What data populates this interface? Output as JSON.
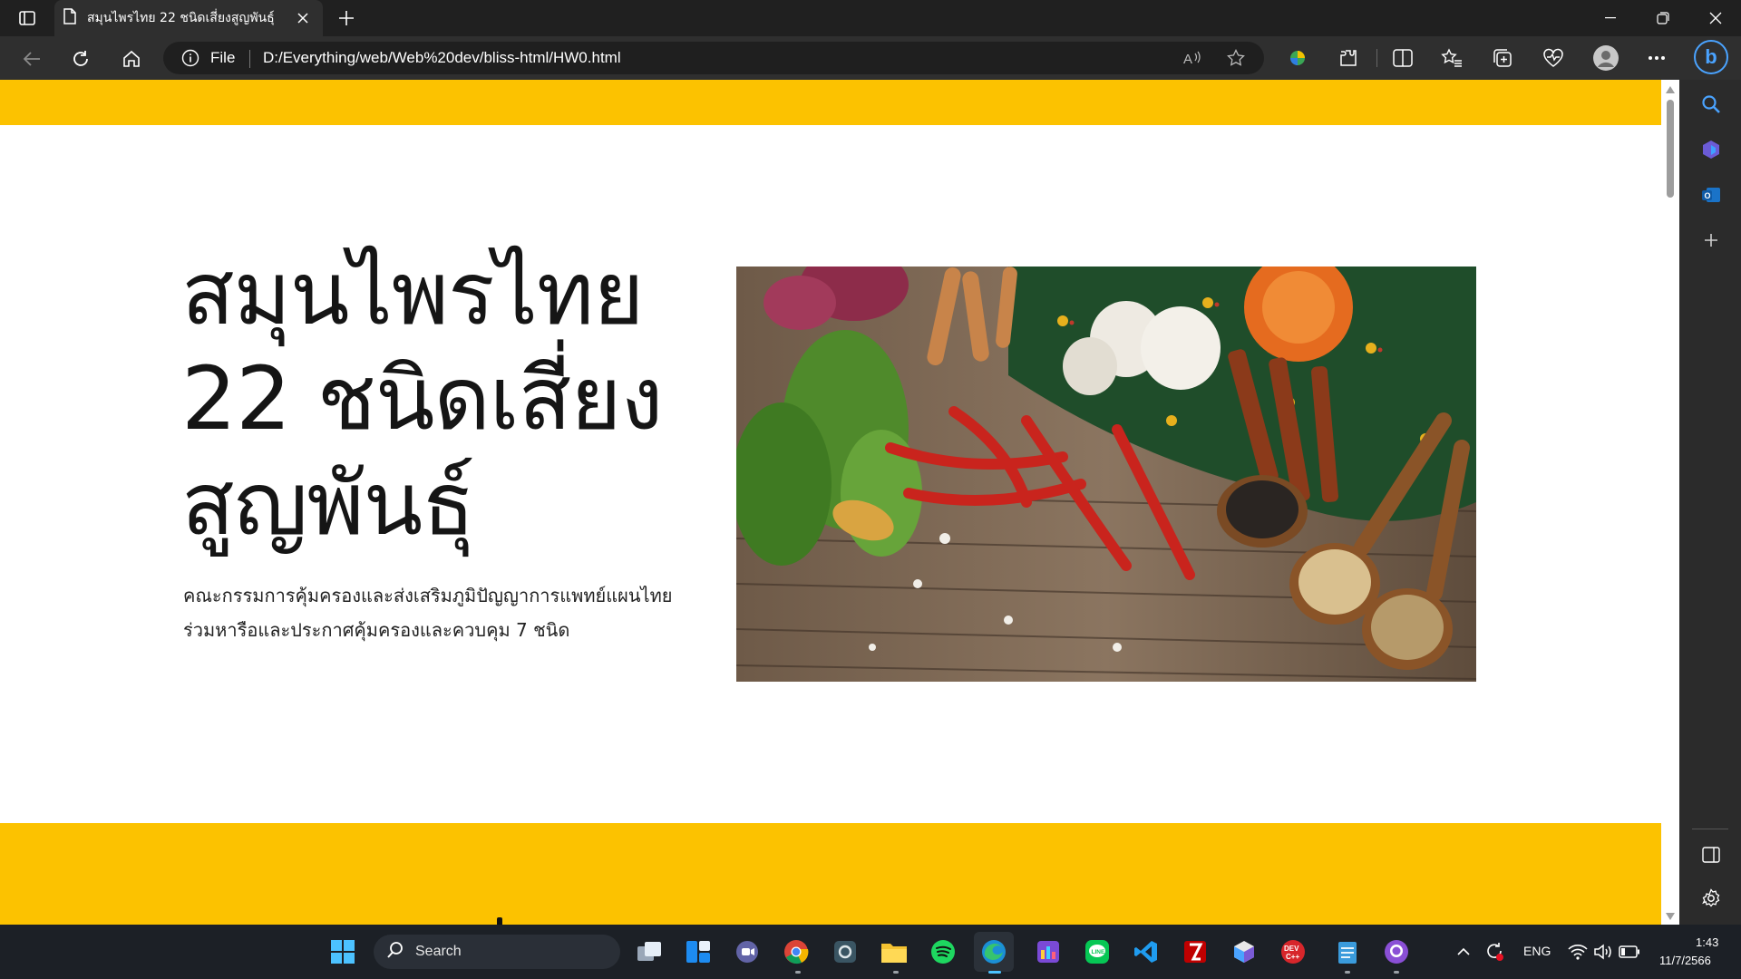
{
  "browser": {
    "tab_title": "สมุนไพรไทย 22 ชนิดเสี่ยงสูญพันธุ์",
    "url_scheme_label": "File",
    "url": "D:/Everything/web/Web%20dev/bliss-html/HW0.html"
  },
  "page": {
    "hero_title_lines": [
      "สมุนไพรไทย",
      "22 ชนิดเสี่ยง",
      "สูญพันธุ์"
    ],
    "hero_description_lines": [
      "คณะกรรมการคุ้มครองและส่งเสริมภูมิปัญญาการแพทย์แผนไทย",
      "ร่วมหารือและประกาศคุ้มครองและควบคุม 7 ชนิด"
    ],
    "accent_color": "#fcc200"
  },
  "taskbar": {
    "search_label": "Search",
    "language": "ENG",
    "time": "1:43",
    "date": "11/7/2566"
  }
}
